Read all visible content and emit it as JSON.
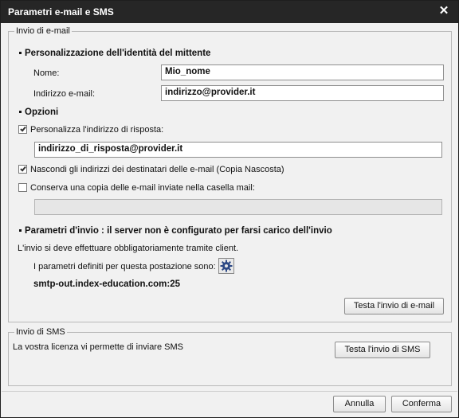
{
  "window": {
    "title": "Parametri e-mail e SMS",
    "close_symbol": "✕"
  },
  "email_group": {
    "legend": "Invio di e-mail",
    "identity": {
      "heading": "Personalizzazione dell'identità del mittente",
      "name_label": "Nome:",
      "name_value": "Mio_nome",
      "email_label": "Indirizzo e-mail:",
      "email_value": "indirizzo@provider.it"
    },
    "options": {
      "heading": "Opzioni",
      "reply_label": "Personalizza l'indirizzo di risposta:",
      "reply_checked": true,
      "reply_value": "indirizzo_di_risposta@provider.it",
      "bcc_label": "Nascondi gli indirizzi dei destinatari delle e-mail (Copia Nascosta)",
      "bcc_checked": true,
      "keep_copy_label": "Conserva una copia delle e-mail inviate nella casella mail:",
      "keep_copy_checked": false,
      "keep_copy_value": ""
    },
    "send_params": {
      "heading": "Parametri d'invio : il server non è configurato per farsi carico dell'invio",
      "info": "L'invio si deve effettuare obbligatoriamente tramite client.",
      "station_label": "I parametri definiti per questa postazione sono:",
      "smtp_value": "smtp-out.index-education.com:25",
      "test_button": "Testa l'invio di e-mail"
    }
  },
  "sms_group": {
    "legend": "Invio di SMS",
    "info": "La vostra licenza vi permette di inviare SMS",
    "test_button": "Testa l'invio di SMS"
  },
  "footer": {
    "cancel": "Annulla",
    "confirm": "Conferma"
  },
  "colors": {
    "titlebar": "#262626",
    "background": "#f1f1f1",
    "border": "#b9b9b9"
  }
}
